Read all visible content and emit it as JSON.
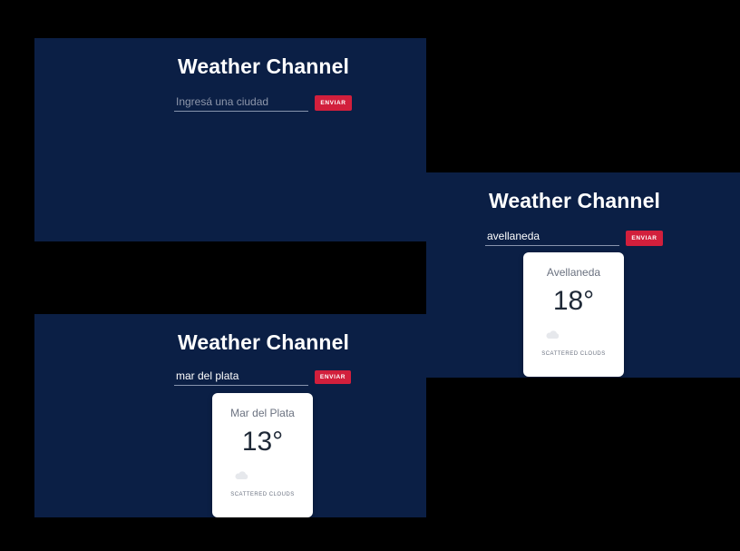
{
  "app": {
    "title": "Weather Channel",
    "accent_color": "#d21f3c",
    "background_color": "#0b1f45"
  },
  "screens": [
    {
      "title": "Weather Channel",
      "search": {
        "value": "",
        "placeholder": "Ingresá una ciudad",
        "button_label": "ENVIAR"
      }
    },
    {
      "title": "Weather Channel",
      "search": {
        "value": "avellaneda",
        "placeholder": "Ingresá una ciudad",
        "button_label": "ENVIAR"
      },
      "card": {
        "city": "Avellaneda",
        "temperature": "18°",
        "icon": "cloud-icon",
        "description": "SCATTERED CLOUDS"
      }
    },
    {
      "title": "Weather Channel",
      "search": {
        "value": "mar del plata",
        "placeholder": "Ingresá una ciudad",
        "button_label": "ENVIAR"
      },
      "card": {
        "city": "Mar del Plata",
        "temperature": "13°",
        "icon": "cloud-icon",
        "description": "SCATTERED CLOUDS"
      }
    }
  ]
}
